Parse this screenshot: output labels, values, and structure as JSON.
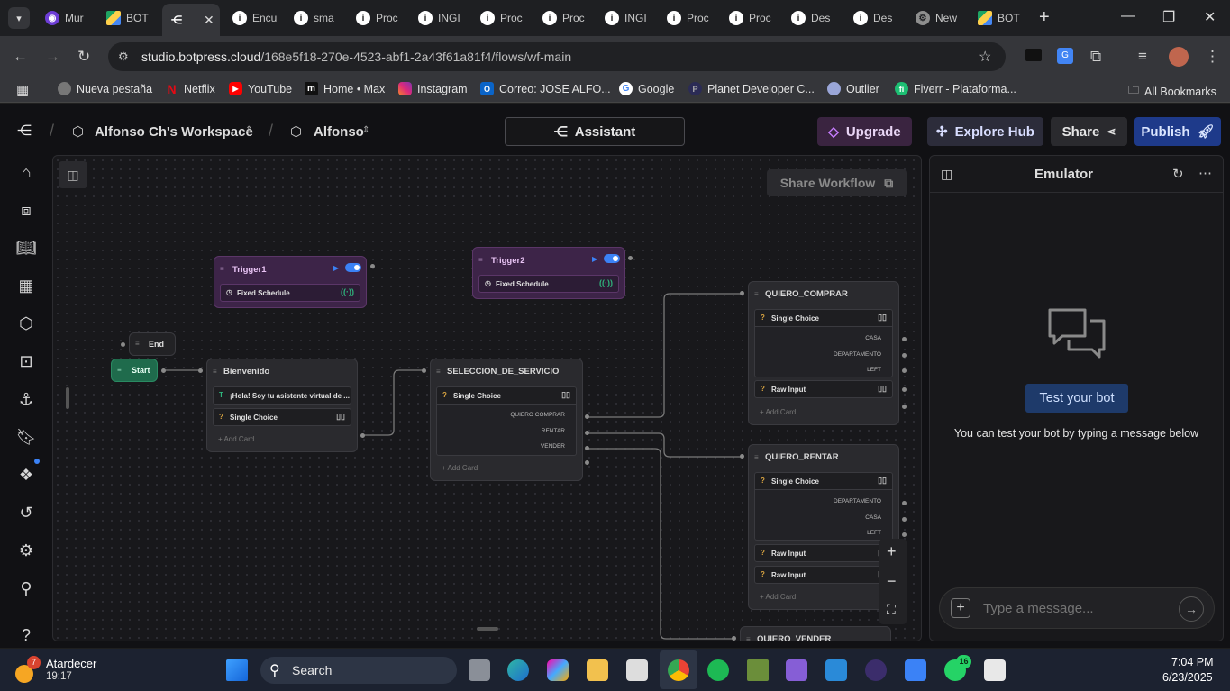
{
  "browser": {
    "tabs": [
      {
        "label": "Mur",
        "icon": "info-icon"
      },
      {
        "label": "BOT",
        "icon": "drive-icon"
      },
      {
        "label": "",
        "icon": "botpress-icon",
        "active": true
      },
      {
        "label": "Encu",
        "icon": "info-icon"
      },
      {
        "label": "sma",
        "icon": "info-icon"
      },
      {
        "label": "Proc",
        "icon": "info-icon"
      },
      {
        "label": "INGI",
        "icon": "info-icon"
      },
      {
        "label": "Proc",
        "icon": "info-icon"
      },
      {
        "label": "Proc",
        "icon": "info-icon"
      },
      {
        "label": "INGI",
        "icon": "info-icon"
      },
      {
        "label": "Proc",
        "icon": "info-icon"
      },
      {
        "label": "Proc",
        "icon": "info-icon"
      },
      {
        "label": "Des",
        "icon": "info-icon"
      },
      {
        "label": "Des",
        "icon": "info-icon"
      },
      {
        "label": "New",
        "icon": "gear-icon"
      },
      {
        "label": "BOT",
        "icon": "drive-icon"
      }
    ],
    "url_host": "studio.botpress.cloud",
    "url_path": "/168e5f18-270e-4523-abf1-2a43f61a81f4/flows/wf-main",
    "bookmarks": [
      {
        "label": "Nueva pestaña",
        "icon": "chrome-icon"
      },
      {
        "label": "Netflix",
        "icon": "netflix-icon"
      },
      {
        "label": "YouTube",
        "icon": "youtube-icon"
      },
      {
        "label": "Home • Max",
        "icon": "max-icon"
      },
      {
        "label": "Instagram",
        "icon": "instagram-icon"
      },
      {
        "label": "Correo: JOSE ALFO...",
        "icon": "outlook-icon"
      },
      {
        "label": "Google",
        "icon": "google-icon"
      },
      {
        "label": "Planet Developer C...",
        "icon": "planet-icon"
      },
      {
        "label": "Outlier",
        "icon": "outlier-icon"
      },
      {
        "label": "Fiverr - Plataforma...",
        "icon": "fiverr-icon"
      }
    ],
    "all_bookmarks": "All Bookmarks"
  },
  "header": {
    "workspace": "Alfonso Ch's Workspace",
    "bot": "Alfonso",
    "assistant": "Assistant",
    "upgrade": "Upgrade",
    "explore_hub": "Explore Hub",
    "share": "Share",
    "publish": "Publish"
  },
  "canvas": {
    "share_workflow": "Share Workflow",
    "trigger1": {
      "title": "Trigger1",
      "card": "Fixed Schedule"
    },
    "trigger2": {
      "title": "Trigger2",
      "card": "Fixed Schedule"
    },
    "end": "End",
    "start": "Start",
    "bienvenido": {
      "title": "Bienvenido",
      "text_card": "¡Hola! Soy tu asistente virtual de ...",
      "choice_card": "Single Choice",
      "add": "Add Card"
    },
    "seleccion": {
      "title": "SELECCION_DE_SERVICIO",
      "choice_card": "Single Choice",
      "choices": [
        "QUIERO COMPRAR",
        "RENTAR",
        "VENDER"
      ],
      "add": "Add Card"
    },
    "comprar": {
      "title": "QUIERO_COMPRAR",
      "choice_card": "Single Choice",
      "choices": [
        "CASA",
        "DEPARTAMENTO",
        "LEFT"
      ],
      "raw": "Raw Input",
      "add": "Add Card"
    },
    "rentar": {
      "title": "QUIERO_RENTAR",
      "choice_card": "Single Choice",
      "choices": [
        "DEPARTAMENTO",
        "CASA",
        "LEFT"
      ],
      "raw1": "Raw Input",
      "raw2": "Raw Input",
      "add": "Add Card"
    },
    "vender": {
      "title": "QUIERO_VENDER"
    }
  },
  "emulator": {
    "title": "Emulator",
    "test_button": "Test your bot",
    "hint": "You can test your bot by typing a message below",
    "placeholder": "Type a message..."
  },
  "taskbar": {
    "weather_badge": "7",
    "weather_title": "Atardecer",
    "weather_time": "19:17",
    "search": "Search",
    "whatsapp_badge": "16",
    "time": "7:04 PM",
    "date": "6/23/2025"
  },
  "colors": {
    "accent": "#3b82f6",
    "upgrade_bg": "#3a2440",
    "publish_bg": "#1e3a8a",
    "start_green": "#1f6b4c"
  }
}
